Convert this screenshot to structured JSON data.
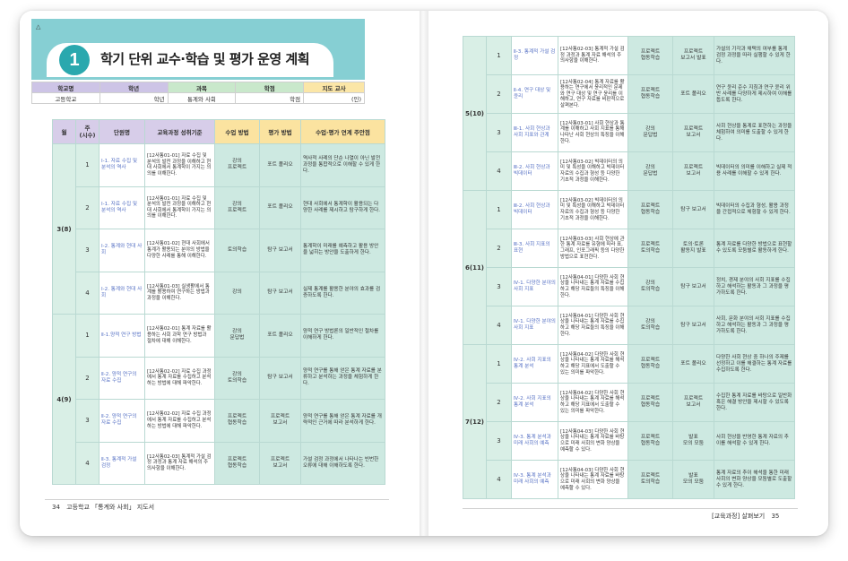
{
  "left_page": {
    "corner_mark": "△",
    "chapter_number": "1",
    "chapter_title": "학기 단위 교수·학습 및 평가 운영 계획",
    "info_labels": [
      "학교명",
      "학년",
      "과목",
      "학점",
      "지도 교사"
    ],
    "info_values": [
      "고등학교",
      "학년",
      "통계와 사회",
      "학점",
      "(인)"
    ],
    "headers": [
      "월",
      "주\n(시수)",
      "단원명",
      "교육과정 성취기준",
      "수업 방법",
      "평가 방법",
      "수업·평가 연계 주안점"
    ],
    "groups": [
      {
        "month": "3(8)",
        "rows": [
          {
            "week": "1",
            "unit": "Ⅰ-1. 자료 수집 및 분석의 역사",
            "std": "[12사통01-01] 자료 수집 및 분석의 발전 과정을 이해하고 현대 사회에서 통계학이 가지는 의의를 이해한다.",
            "m1": "강의\n프로젝트",
            "m2": "포트 폴리오",
            "conn": "역사적 사례의 단순 나열이 아닌 발전 과정을 통합적으로 이해할 수 있게 한다."
          },
          {
            "week": "2",
            "unit": "Ⅰ-1. 자료 수집 및 분석의 역사",
            "std": "[12사통01-01] 자료 수집 및 분석의 발전 과정을 이해하고 현대 사회에서 통계학이 가지는 의의를 이해한다.",
            "m1": "강의\n프로젝트",
            "m2": "포트 폴리오",
            "conn": "현대 사회에서 통계학이 활용되는 다양한 사례를 제시하고 탐구하게 한다."
          },
          {
            "week": "3",
            "unit": "Ⅰ-2. 통계와 현대 사회",
            "std": "[12사통01-02] 현대 사회에서 통계가 활용되는 분야의 방법을 다양한 사례를 통해 이해한다.",
            "m1": "토의학습",
            "m2": "탐구 보고서",
            "conn": "통계학이 미래를 예측하고 활용 방안을 넓히는 방안을 도출하게 한다."
          },
          {
            "week": "4",
            "unit": "Ⅰ-2. 통계와 현대 사회",
            "std": "[12사통01-03] 실생활에서 통계를 활용하여 연구하는 방법과 과정을 이해한다.",
            "m1": "강의",
            "m2": "탐구 보고서",
            "conn": "실제 통계를 활용한 분야의 효과를 검증하도록 한다."
          }
        ]
      },
      {
        "month": "4(9)",
        "rows": [
          {
            "week": "1",
            "unit": "Ⅱ-1.양적 연구 방법",
            "std": "[12사통02-01] 통계 자료를 활용하는 사회 과학 연구 방법과 절차에 대해 이해한다.",
            "m1": "강의\n문답법",
            "m2": "포트 폴리오",
            "conn": "양적 연구 방법론의 일반적인 절차를 이해하게 한다."
          },
          {
            "week": "2",
            "unit": "Ⅱ-2. 양적 연구의 자료 수집",
            "std": "[12사통02-02] 자료 수집 과정에서 통계 자료를 수집하고 분석하는 방법에 대해 파악한다.",
            "m1": "강의\n토의학습",
            "m2": "탐구 보고서",
            "conn": "양적 연구를 통해 얻은 통계 자료를 분류하고 분석하는 과정을 체험하게 한다."
          },
          {
            "week": "3",
            "unit": "Ⅱ-2. 양적 연구의 자료 수집",
            "std": "[12사통02-02] 자료 수집 과정에서 통계 자료를 수집하고 분석하는 방법에 대해 파악한다.",
            "m1": "프로젝트\n협동학습",
            "m2": "프로젝트\n보고서",
            "conn": "양적 연구를 통해 얻은 통계 자료를 개략적인 근거에 따라 분석하게 한다."
          },
          {
            "week": "4",
            "unit": "Ⅱ-3. 통계적 가설 검정",
            "std": "[12사통02-03] 통계적 가설 검정 과정과 통계 자료 해석의 주의사항을 이해한다.",
            "m1": "프로젝트\n협동학습",
            "m2": "프로젝트\n보고서",
            "conn": "가설 검정 과정에서 나타나는 빈번한 오류에 대해 이해하도록 한다."
          }
        ]
      }
    ],
    "footer_page": "34",
    "footer_text": "고등학교 「통계와 사회」 지도서"
  },
  "right_page": {
    "groups": [
      {
        "month": "5(10)",
        "rows": [
          {
            "week": "1",
            "unit": "Ⅱ-3. 통계적 가설 검정",
            "std": "[12사통02-03] 통계적 가설 검정 과정과 통계 자료 해석의 주의사항을 이해한다.",
            "m1": "프로젝트\n협동학습",
            "m2": "프로젝트\n보고서 발표",
            "conn": "가설의 기각과 채택의 여부를 통계 검정 과정을 따라 실행할 수 있게 한다."
          },
          {
            "week": "2",
            "unit": "Ⅱ-4. 연구 대상 및 윤리",
            "std": "[12사통02-04] 통계 자료를 활용하는 연구에서 윤리적인 문제와 연구 대상 및 연구 윤리를 이해하고, 연구 자료를 비판적으로 살펴본다.",
            "m1": "프로젝트\n협동학습",
            "m2": "포트 폴리오",
            "conn": "연구 윤리 준수 지침과 연구 윤리 위반 사례를 다양하게 제시하여 이해를 돕도록 한다."
          },
          {
            "week": "3",
            "unit": "Ⅲ-1. 사회 현상과 사회 지표와 관계",
            "std": "[12사통03-01] 사회 현상과 통계를 이해하고 사회 지표를 통해 나타난 사회 현상의 특징을 이해한다.",
            "m1": "강의\n문답법",
            "m2": "프로젝트\n보고서",
            "conn": "사회 현상을 통계로 표현하는 과정을 체험하여 의미를 도출할 수 있게 한다."
          },
          {
            "week": "4",
            "unit": "Ⅲ-2. 사회 현상과 빅데이터",
            "std": "[12사통03-02] 빅데이터의 의미 및 특성을 이해하고 빅데이터 자료의 수집과 형성 등 다양한 기초적 과정을 이해한다.",
            "m1": "강의\n문답법",
            "m2": "프로젝트\n보고서",
            "conn": "빅데이터의 의미를 이해하고 실제 적용 사례를 이해할 수 있게 한다."
          }
        ]
      },
      {
        "month": "6(11)",
        "rows": [
          {
            "week": "1",
            "unit": "Ⅲ-2. 사회 현상과 빅데이터",
            "std": "[12사통03-02] 빅데이터의 의미 및 특성을 이해하고 빅데이터 자료의 수집과 형성 등 다양한 기초적 과정을 이해한다.",
            "m1": "프로젝트\n협동학습",
            "m2": "탐구 보고서",
            "conn": "빅데이터의 수집과 형성, 활용 과정을 간접적으로 체험할 수 있게 한다."
          },
          {
            "week": "2",
            "unit": "Ⅲ-3. 사회 지표의 표현",
            "std": "[12사통03-03] 사회 현상에 관한 통계 자료를 유형에 따라 표, 그래프, 인포그래픽 등의 다양한 방법으로 표현한다.",
            "m1": "프로젝트\n토의학습",
            "m2": "토의·토론\n활동지 발표",
            "conn": "통계 자료를 다양한 방법으로 표현할 수 있도록 모둠별로 활동하게 한다."
          },
          {
            "week": "3",
            "unit": "Ⅳ-1. 다양한 분야의 사회 지표",
            "std": "[12사통04-01] 다양한 사회 현상을 나타내는 통계 자료를 수집하고 해당 자료들의 특징을 이해한다.",
            "m1": "강의\n토의학습",
            "m2": "탐구 보고서",
            "conn": "정치, 경제 분야의 사회 지표를 수집하고 해석하는 활동과 그 과정을 평가하도록 한다."
          },
          {
            "week": "4",
            "unit": "Ⅳ-1. 다양한 분야의 사회 지표",
            "std": "[12사통04-01] 다양한 사회 현상을 나타내는 통계 자료를 수집하고 해당 자료들의 특징을 이해한다.",
            "m1": "강의\n토의학습",
            "m2": "탐구 보고서",
            "conn": "사회, 문화 분야의 사회 지표를 수집하고 해석하는 활동과 그 과정을 평가하도록 한다."
          }
        ]
      },
      {
        "month": "7(12)",
        "rows": [
          {
            "week": "1",
            "unit": "Ⅳ-2. 사회 지표의 통계 분석",
            "std": "[12사통04-02] 다양한 사회 현상을 나타내는 통계 자료를 해석하고 해당 지표에서 도출할 수 있는 의미를 파악한다.",
            "m1": "프로젝트\n협동학습",
            "m2": "포트 폴리오",
            "conn": "다양한 사회 현상 중 하나의 주제를 선정하고 이를 해결하는 통계 자료를 수집하도록 한다."
          },
          {
            "week": "2",
            "unit": "Ⅳ-2. 사회 지표의 통계 분석",
            "std": "[12사통04-02] 다양한 사회 현상을 나타내는 통계 자료를 해석하고 해당 지표에서 도출할 수 있는 의미를 파악한다.",
            "m1": "프로젝트\n협동학습",
            "m2": "프로젝트\n보고서",
            "conn": "수집한 통계 자료를 바탕으로 일반화 혹은 해결 방안을 제시할 수 있도록 한다."
          },
          {
            "week": "3",
            "unit": "Ⅳ-3. 통계 분석과 미래 사회의 예측",
            "std": "[12사통04-03] 다양한 사회 현상을 나타내는 통계 자료를 바탕으로 미래 사회의 변화 양상을 예측할 수 있다.",
            "m1": "프로젝트\n협동학습",
            "m2": "발표\n모의 모둠",
            "conn": "사회 현상을 반영한 통계 자료의 추이를 해석할 수 있게 한다."
          },
          {
            "week": "4",
            "unit": "Ⅳ-3. 통계 분석과 미래 사회의 예측",
            "std": "[12사통04-03] 다양한 사회 현상을 나타내는 통계 자료를 바탕으로 미래 사회의 변화 양상을 예측할 수 있다.",
            "m1": "프로젝트\n토의학습",
            "m2": "발표\n모의 모둠",
            "conn": "통계 자료의 추이 해석을 통한 미래 사회의 변화 양상을 모둠별로 도출할 수 있게 한다."
          }
        ]
      }
    ],
    "footer_text": "[교육과정] 살펴보기",
    "footer_page": "35"
  }
}
